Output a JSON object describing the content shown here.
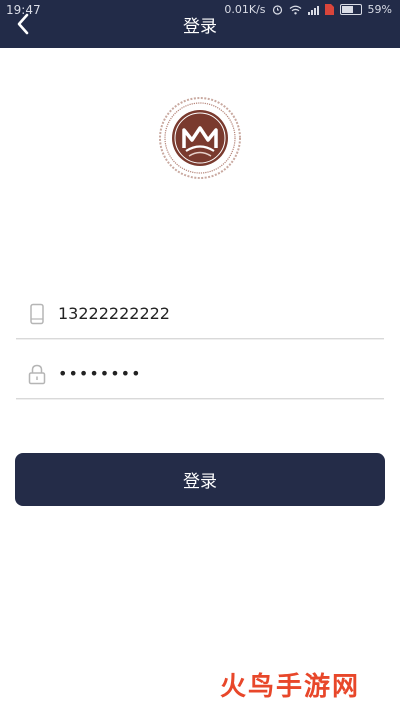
{
  "status_bar": {
    "time": "19:47",
    "network_speed": "0.01K/s",
    "battery_percent": "59%",
    "battery_level": 0.59
  },
  "header": {
    "title": "登录",
    "background_color": "#222b48"
  },
  "logo": {
    "icon": "organization-seal-logo",
    "colors": {
      "primary": "#7a3a2e",
      "secondary": "#ffffff"
    }
  },
  "form": {
    "phone": {
      "icon": "phone-icon",
      "value": "13222222222"
    },
    "password": {
      "icon": "lock-icon",
      "value": "••••••••"
    },
    "login_button": {
      "label": "登录",
      "color": "#242c48"
    }
  },
  "watermark": {
    "text": "火鸟手游网",
    "color": "#e8472a"
  }
}
